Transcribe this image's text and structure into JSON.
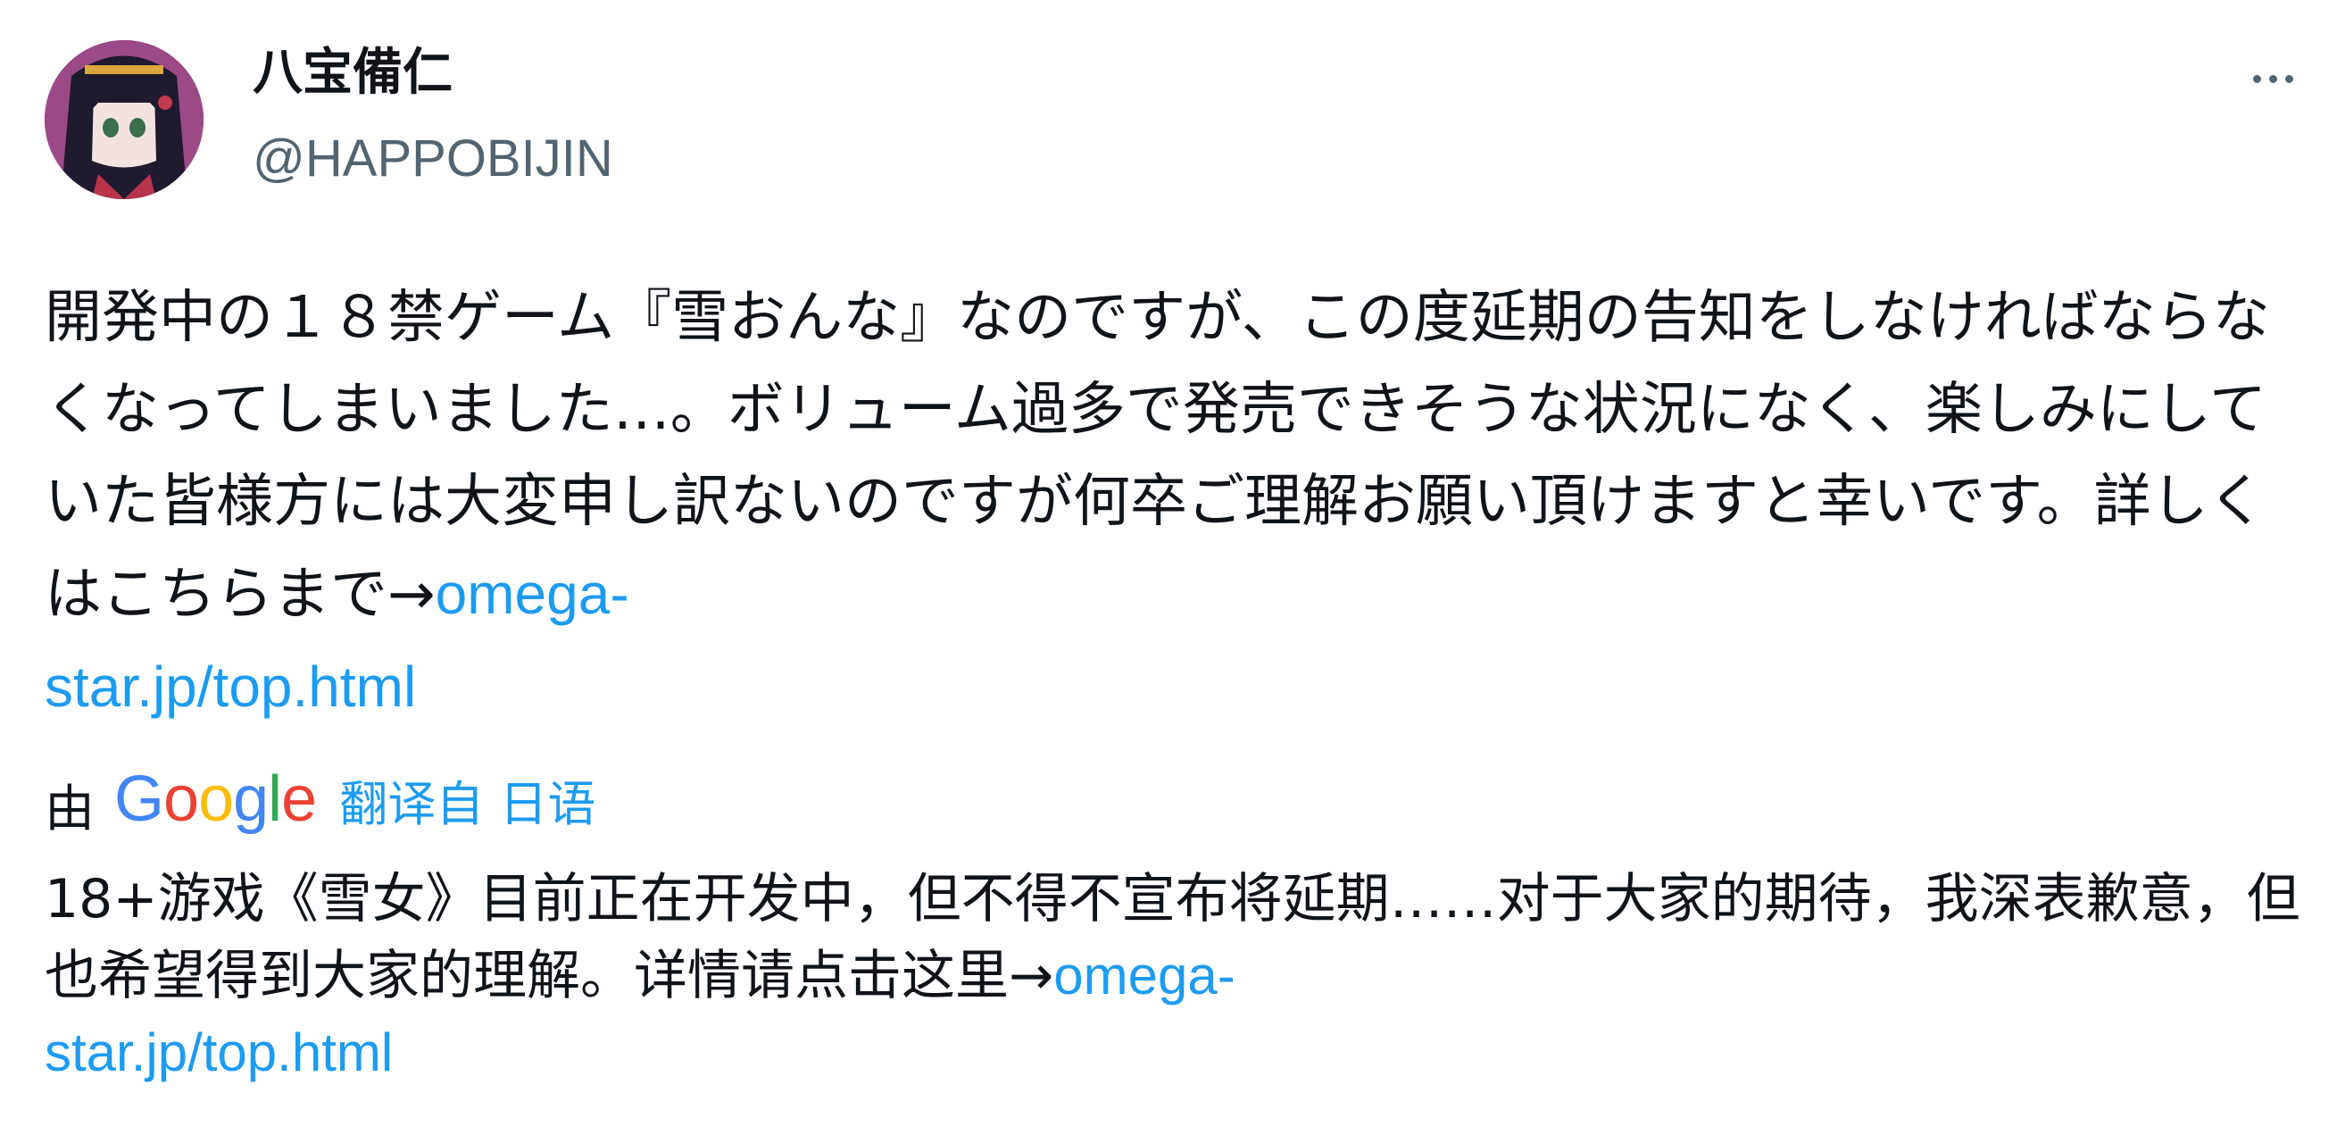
{
  "user": {
    "display_name": "八宝備仁",
    "handle": "@HAPPOBIJIN"
  },
  "tweet": {
    "text": "開発中の１８禁ゲーム『雪おんな』なのですが、この度延期の告知をしなければならなくなってしまいました…。ボリューム過多で発売できそうな状況になく、楽しみにしていた皆様方には大変申し訳ないのですが何卒ご理解お願い頂けますと幸いです。詳しくはこちらまで→",
    "link_part1": "omega-",
    "link_part2": "star.jp/top.html"
  },
  "translation": {
    "by_label": "由",
    "google_letters": [
      "G",
      "o",
      "o",
      "g",
      "l",
      "e"
    ],
    "google_colors": [
      "#4285F4",
      "#EA4335",
      "#FBBC05",
      "#4285F4",
      "#34A853",
      "#EA4335"
    ],
    "translated_from": "翻译自 日语",
    "text": "18+游戏《雪女》目前正在开发中，但不得不宣布将延期……对于大家的期待，我深表歉意，但也希望得到大家的理解。详情请点击这里→",
    "link_part1": "omega-",
    "link_part2": "star.jp/top.html"
  },
  "icons": {
    "more": "more-horizontal-icon",
    "avatar": "avatar-image"
  },
  "colors": {
    "link": "#1d9bf0",
    "secondary": "#536471",
    "text": "#0f1419"
  }
}
